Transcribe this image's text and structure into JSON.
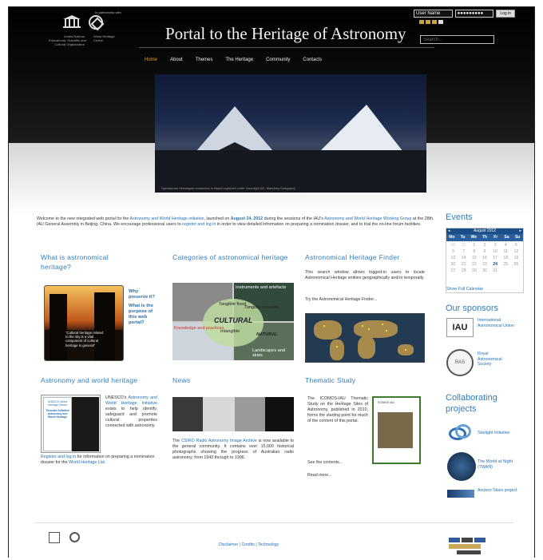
{
  "header": {
    "site_title": "Portal to the Heritage of Astronomy",
    "unesco_small_left": "United Nations\nEducational, Scientific and\nCultural Organization",
    "unesco_small_right": "World Heritage\nCentre",
    "partnership": "In partnership with",
    "login": {
      "username_value": "User Name",
      "password_value": "●●●●●●●●●",
      "login_label": "Log in"
    },
    "search_placeholder": "Search..."
  },
  "nav": {
    "items": [
      "Home",
      "About",
      "Themes",
      "The Heritage",
      "Community",
      "Contacts"
    ]
  },
  "hero": {
    "caption": "Spectacular Himalayan mountains in Nepal captured under moonlight (Dr. Mandeep Dasgupta)"
  },
  "welcome": {
    "part1": "Welcome to the new integrated web portal for the",
    "initiative_link": "Astronomy and World Heritage initiative",
    "part2": ", launched on",
    "date": "August 24, 2012",
    "part3": "during the sessions of the IAU's",
    "wg_link": "Astronomy and World Heritage Working Group",
    "part4": "at the 28th IAU General Assembly in Beijing, China. We encourage professional users to",
    "register_link": "register and log in",
    "part5": "in order to view detailed information on preparing a nomination dossier, and to trial the on-line forum facilities."
  },
  "sections": {
    "what_is": {
      "title": "What is astronomical heritage?",
      "quote": "\"Cultural heritage related to the sky is a vital component of cultural heritage in general\"",
      "link1": "Why preserve it?",
      "link2": "What is the purpose of this web portal?"
    },
    "categories": {
      "title": "Categories of astronomical heritage",
      "labels": {
        "tangible_fixed": "Tangible fixed",
        "tangible_movable": "Tangible movable",
        "instruments": "Instruments and artefacts",
        "cultural": "CULTURAL",
        "intangible": "Intangible",
        "natural": "NATURAL",
        "knowledge": "Knowledge and practices",
        "landscapes": "Landscapes and skies"
      }
    },
    "finder": {
      "title": "Astronomical Heritage Finder",
      "text": "This search window allows logged-in users to locate Astronomical Heritage entities geographically and/or temporally.",
      "link": "Try the Astronomical Heritage Finder..."
    },
    "astro_world": {
      "title": "Astronomy and world heritage",
      "text_pre": "UNESCO's",
      "text_link": "Astronomy and World Heritage Initiative",
      "text_post": "exists to help identify, safeguard and promote cultural properties connected with astronomy.",
      "register_link": "Register and log in",
      "register_post": "for information on preparing a nomination dossier for the",
      "whl_link": "World Heritage List.",
      "book_title": "UNESCO World Heritage Centre",
      "book_sub": "Thematic Initiative Astronomy and World Heritage"
    },
    "news": {
      "title": "News",
      "text_pre": "The",
      "text_link": "CSIRO Radio Astronomy Image Archive",
      "text_post": "is now available to the general community. It contains over 15,000 historical photographs showing the progress of Australian radio astronomy, from 1943 through to 1996."
    },
    "thematic": {
      "title": "Thematic Study",
      "text": "The ICOMOS-IAU Thematic Study on the Heritage Sites of Astronomy, published in 2010, forms the starting point for much of the content of this portal.",
      "link1": "See the contents...",
      "link2": "Read more...",
      "cover_title": "ICOMOS  IAU"
    }
  },
  "sidebar": {
    "events_title": "Events",
    "calendar": {
      "month": "August 2012",
      "days": [
        "Mo",
        "Tu",
        "We",
        "Th",
        "Fr",
        "Sa",
        "Su"
      ],
      "rows": [
        [
          "30",
          "31",
          "1",
          "2",
          "3",
          "4",
          "5"
        ],
        [
          "6",
          "7",
          "8",
          "9",
          "10",
          "11",
          "12"
        ],
        [
          "13",
          "14",
          "15",
          "16",
          "17",
          "18",
          "19"
        ],
        [
          "20",
          "21",
          "22",
          "23",
          "24",
          "25",
          "26"
        ],
        [
          "27",
          "28",
          "29",
          "30",
          "31",
          "",
          ""
        ]
      ],
      "show_full": "Show Full Calendar"
    },
    "sponsors_title": "Our sponsors",
    "sponsors": [
      {
        "logo": "IAU",
        "name": "International Astronomical Union"
      },
      {
        "logo": "RAS",
        "name": "Royal Astronomical Society"
      }
    ],
    "collab_title": "Collaborating projects",
    "collab": [
      {
        "name": "Starlight Initiative"
      },
      {
        "name": "The World at Night (TWAN)"
      },
      {
        "name": "Ancient Skies project"
      }
    ]
  },
  "footer": {
    "links": "Disclaimer | Credits | Technology"
  },
  "colors": {
    "link": "#2470b5",
    "heading": "#2f7ec2",
    "nav_active": "#e89c1e",
    "calendar_header": "#1b4e86"
  }
}
